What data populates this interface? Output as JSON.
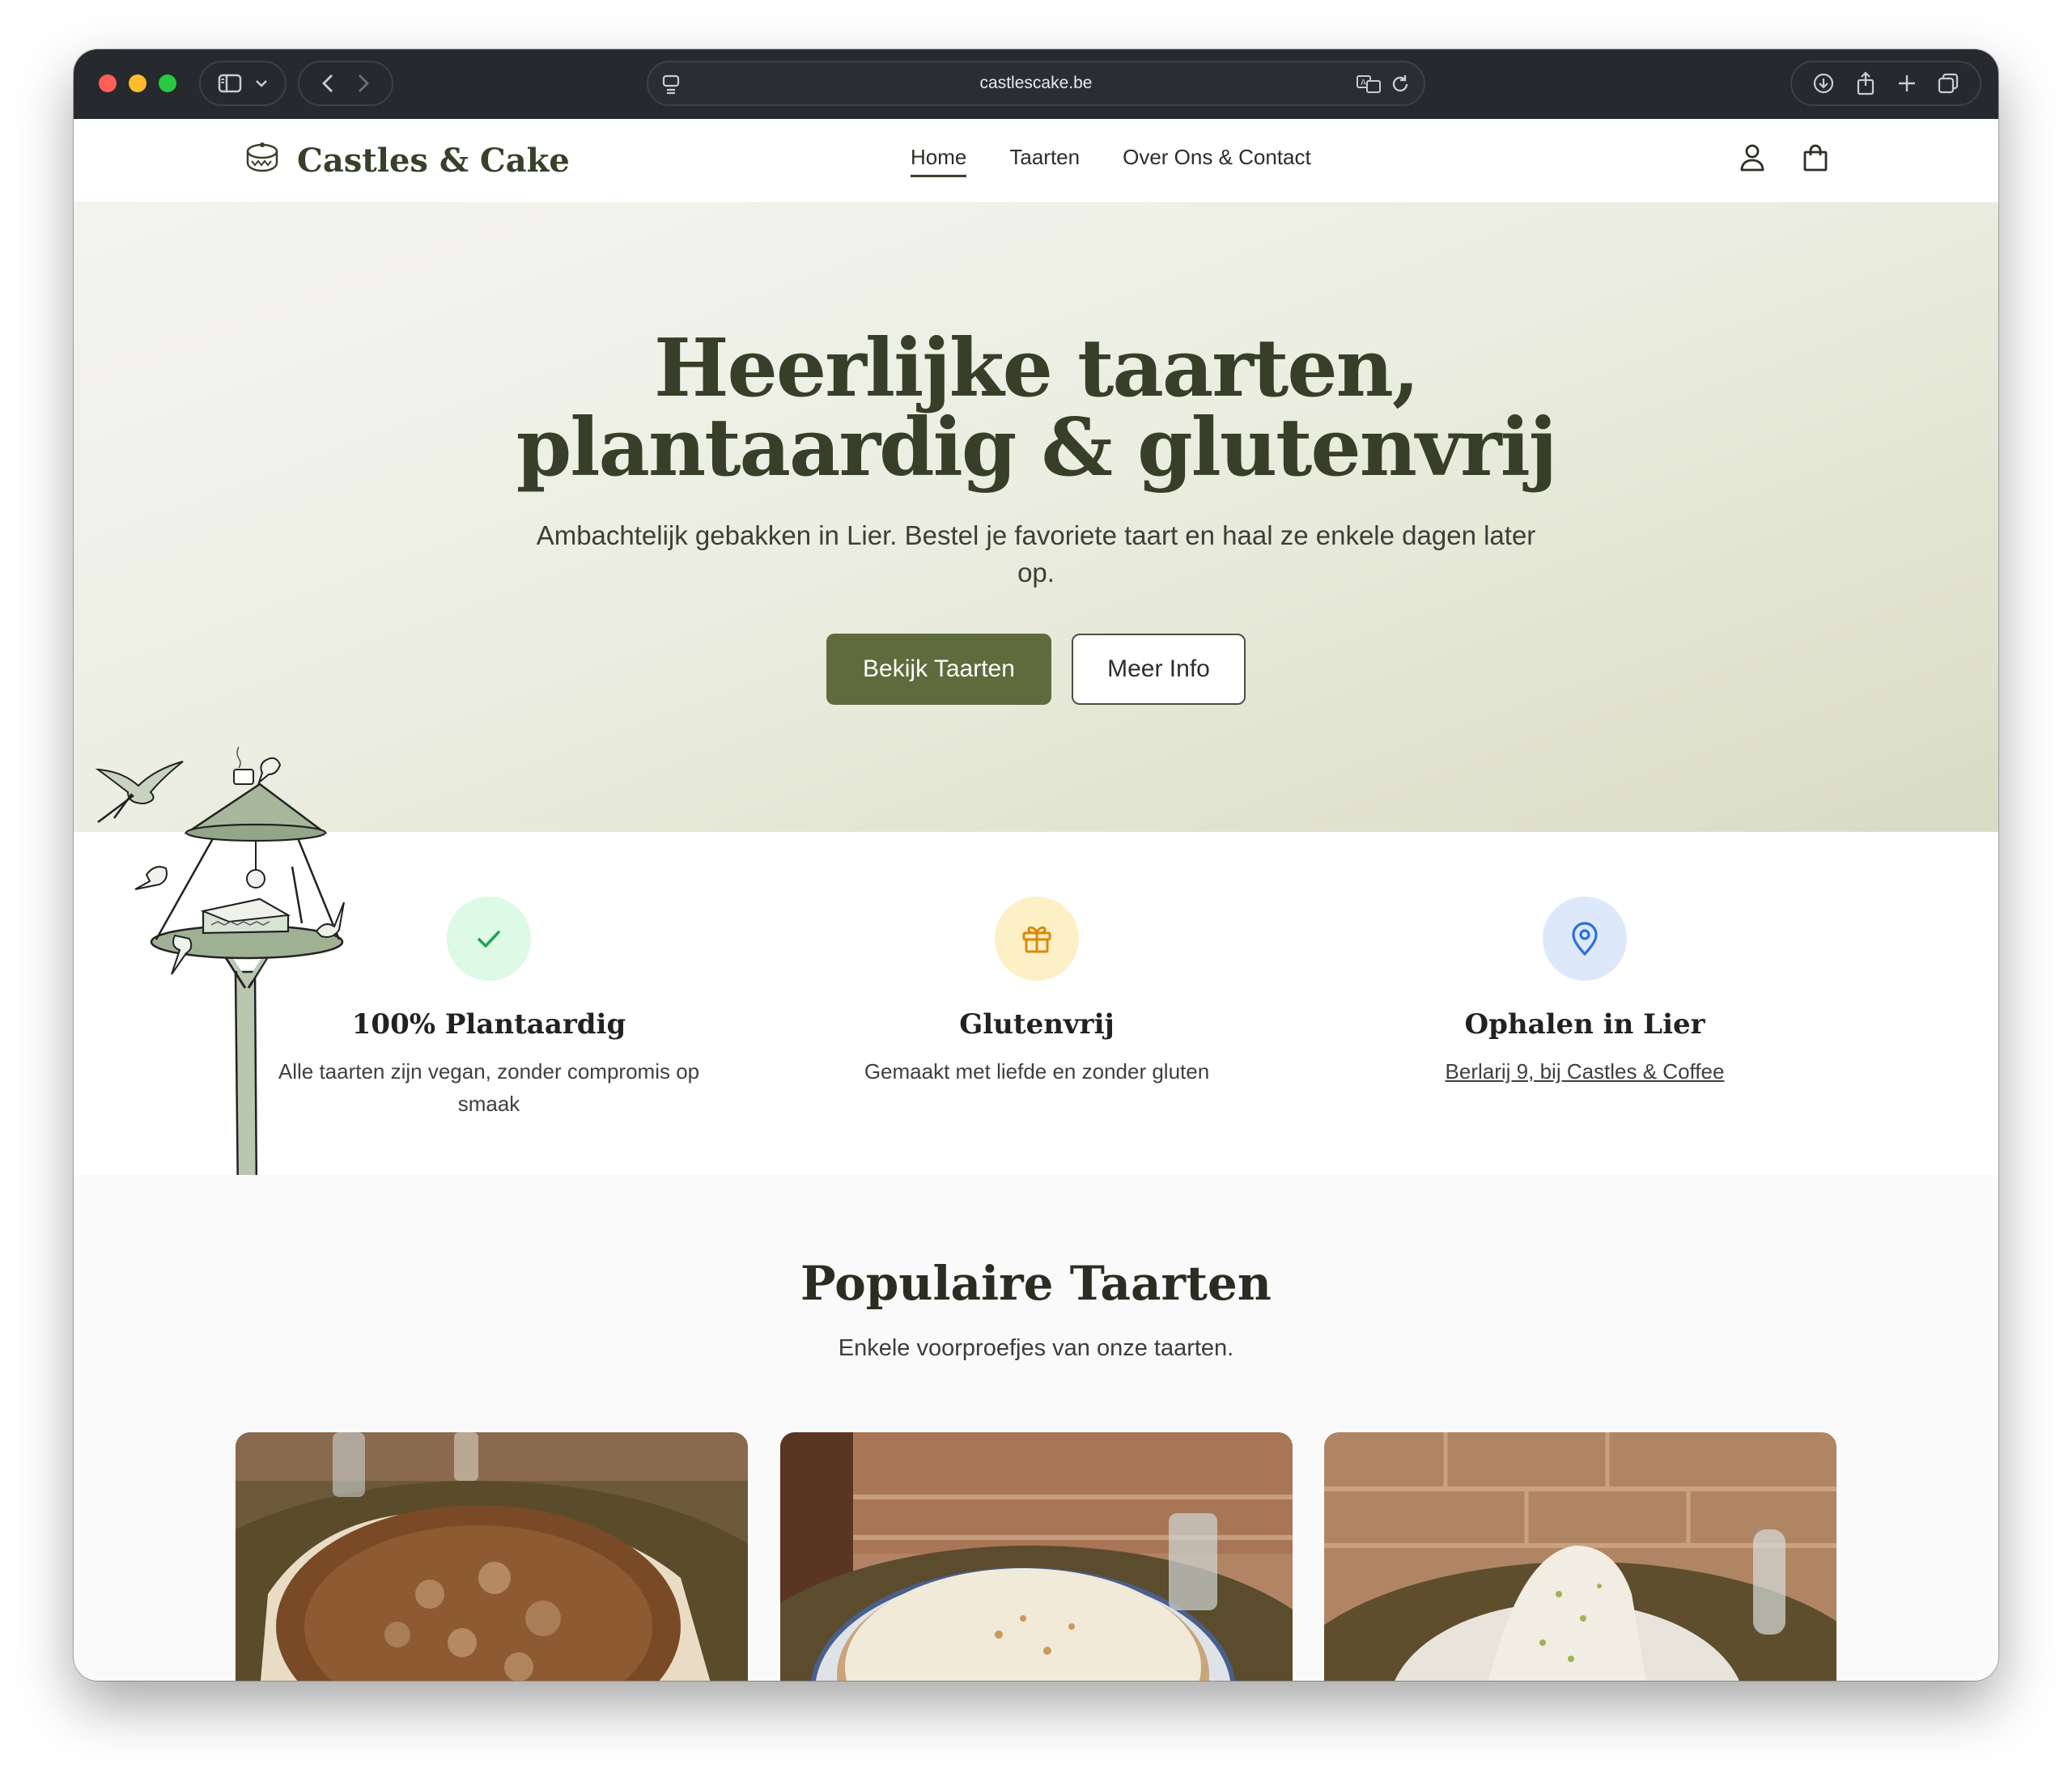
{
  "browser": {
    "url": "castlescake.be"
  },
  "nav": {
    "brand": "Castles & Cake",
    "links": [
      {
        "label": "Home",
        "active": true
      },
      {
        "label": "Taarten",
        "active": false
      },
      {
        "label": "Over Ons & Contact",
        "active": false
      }
    ],
    "icons": [
      "user-icon",
      "shopping-bag-icon"
    ]
  },
  "hero": {
    "title_line1": "Heerlijke taarten,",
    "title_line2": "plantaardig & glutenvrij",
    "subtitle": "Ambachtelijk gebakken in Lier. Bestel je favoriete taart en haal ze enkele dagen later op.",
    "primary_button": "Bekijk Taarten",
    "secondary_button": "Meer Info"
  },
  "features": [
    {
      "icon": "check-icon",
      "title": "100% Plantaardig",
      "description": "Alle taarten zijn vegan, zonder compromis op smaak",
      "color": "#22a350"
    },
    {
      "icon": "gift-icon",
      "title": "Glutenvrij",
      "description": "Gemaakt met liefde en zonder gluten",
      "color": "#d98a0a"
    },
    {
      "icon": "map-pin-icon",
      "title": "Ophalen in Lier",
      "description": "Berlarij 9, bij Castles & Coffee",
      "color": "#2e6fdc"
    }
  ],
  "popular": {
    "title": "Populaire Taarten",
    "subtitle": "Enkele voorproefjes van onze taarten."
  },
  "colors": {
    "brand_dark": "#37402a",
    "brand_button": "#5f6b3c"
  }
}
